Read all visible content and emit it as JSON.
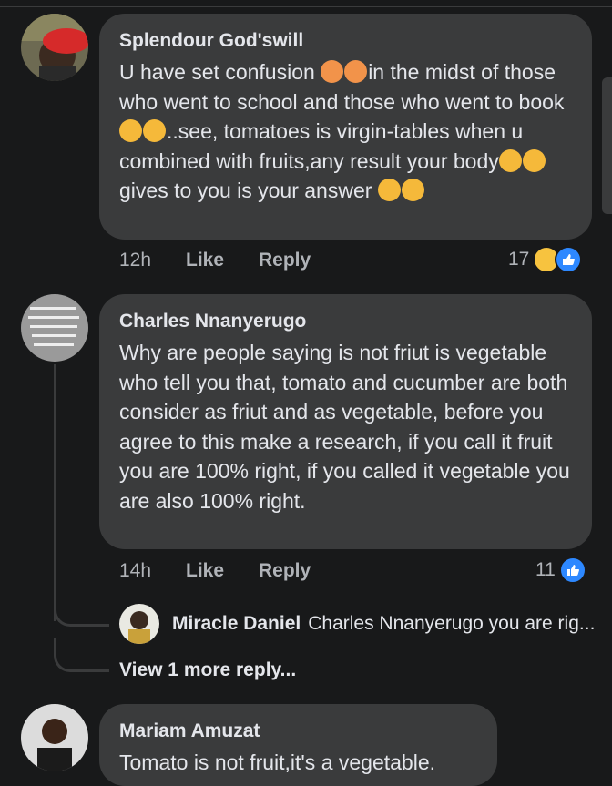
{
  "comments": [
    {
      "author": "Splendour God'swill",
      "text_parts": [
        "U have set confusion ",
        "in the midst of those who went to school and those who went to book",
        "..see, tomatoes is virgin-tables when u combined with fruits,any result your body",
        " gives to you is your answer "
      ],
      "time": "12h",
      "like_label": "Like",
      "reply_label": "Reply",
      "reaction_count": "17"
    },
    {
      "author": "Charles Nnanyerugo",
      "text": "Why are people  saying is not friut is vegetable who  tell  you  that, tomato and cucumber  are both consider as friut and as vegetable, before you agree to this make a research, if you call it fruit you  are 100% right, if you called it vegetable  you are  also 100% right.",
      "time": "14h",
      "like_label": "Like",
      "reply_label": "Reply",
      "reaction_count": "11",
      "reply": {
        "author": "Miracle Daniel",
        "text": "Charles Nnanyerugo you are rig..."
      },
      "view_more": "View 1 more reply..."
    },
    {
      "author": "Mariam Amuzat",
      "text": "Tomato is not fruit,it's a vegetable."
    }
  ]
}
